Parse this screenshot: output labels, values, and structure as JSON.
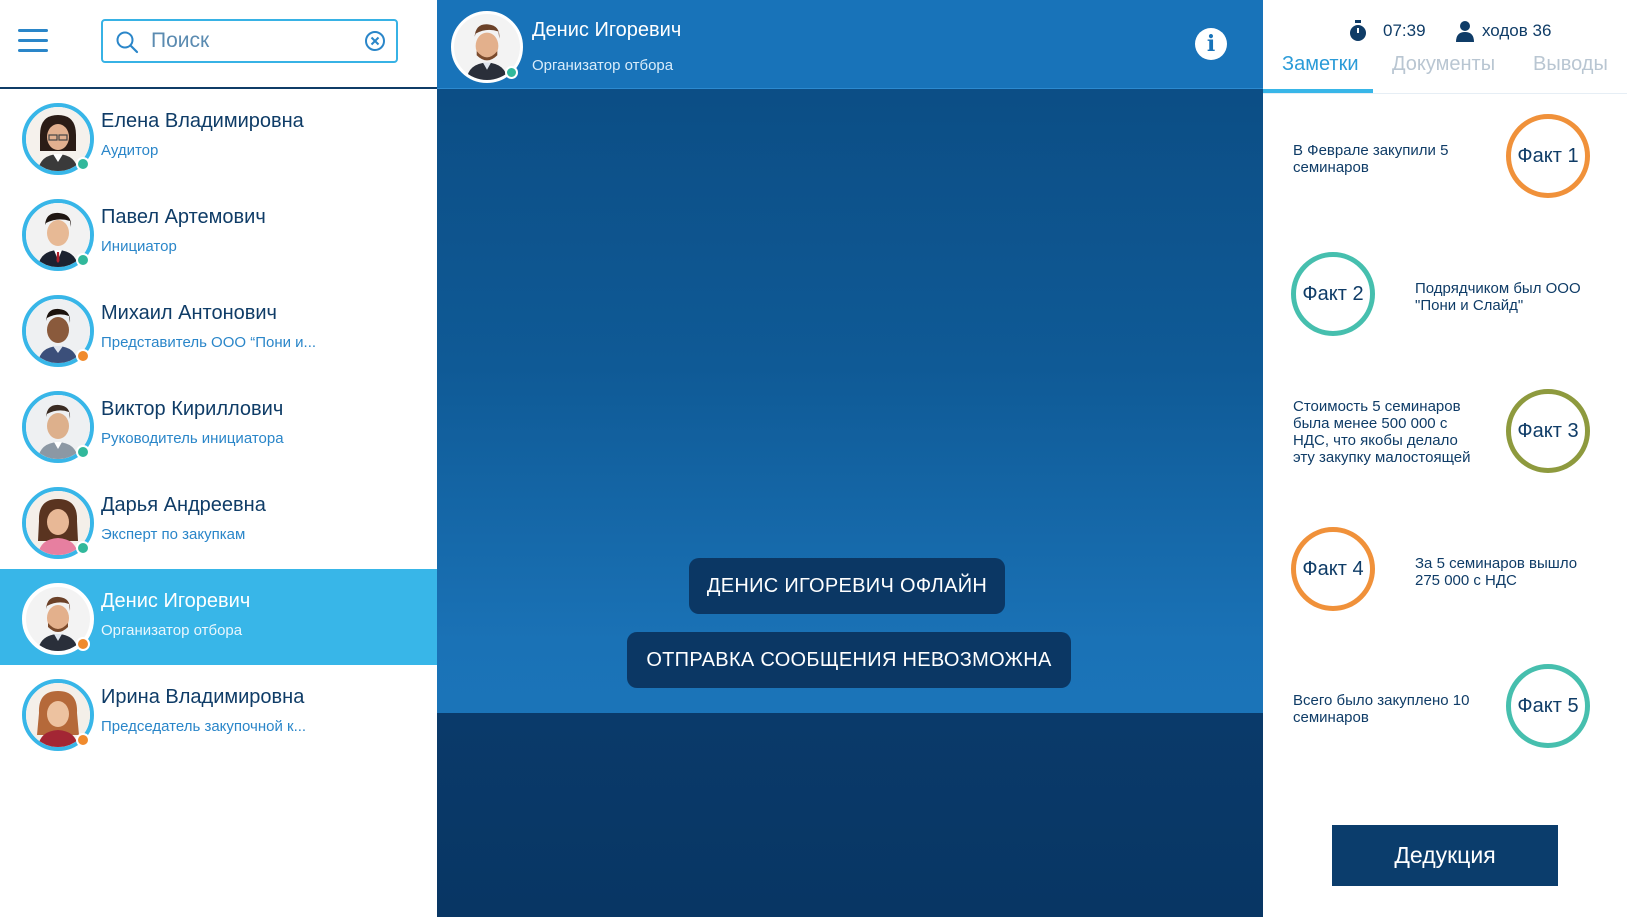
{
  "search": {
    "placeholder": "Поиск"
  },
  "contacts": [
    {
      "name": "Елена Владимировна",
      "role": "Аудитор",
      "status_color": "#31b89b",
      "active": false
    },
    {
      "name": "Павел Артемович",
      "role": "Инициатор",
      "status_color": "#31b89b",
      "active": false
    },
    {
      "name": "Михаил Антонович",
      "role": "Представитель ООО “Пони и...",
      "status_color": "#f08a2c",
      "active": false
    },
    {
      "name": "Виктор Кириллович",
      "role": "Руководитель инициатора",
      "status_color": "#31b89b",
      "active": false
    },
    {
      "name": "Дарья Андреевна",
      "role": "Эксперт по закупкам",
      "status_color": "#31b89b",
      "active": false
    },
    {
      "name": "Денис Игоревич",
      "role": "Организатор отбора",
      "status_color": "#f08a2c",
      "active": true
    },
    {
      "name": "Ирина Владимировна",
      "role": "Председатель закупочной к...",
      "status_color": "#f08a2c",
      "active": false
    }
  ],
  "chat": {
    "name": "Денис Игоревич",
    "role": "Организатор отбора",
    "status_color": "#31b89b",
    "messages": [
      "ДЕНИС ИГОРЕВИЧ ОФЛАЙН",
      "ОТПРАВКА СООБЩЕНИЯ НЕВОЗМОЖНА"
    ]
  },
  "stats": {
    "timer": "07:39",
    "moves": "ходов 36"
  },
  "tabs": [
    {
      "label": "Заметки",
      "active": true
    },
    {
      "label": "Документы",
      "active": false
    },
    {
      "label": "Выводы",
      "active": false
    }
  ],
  "facts": [
    {
      "label": "Факт 1",
      "text": "В Феврале закупили 5 семинаров",
      "color": "#f0913a"
    },
    {
      "label": "Факт 2",
      "text": "Подрядчиком был ООО \"Пони и Слайд\"",
      "color": "#46bfae"
    },
    {
      "label": "Факт 3",
      "text": "Стоимость 5 семинаров была менее 500 000 с НДС, что якобы делало эту закупку малостоящей",
      "color": "#8e9a3e"
    },
    {
      "label": "Факт 4",
      "text": "За 5 семинаров вышло 275 000 с НДС",
      "color": "#f0913a"
    },
    {
      "label": "Факт 5",
      "text": "Всего было закуплено 10 семинаров",
      "color": "#46bfae"
    }
  ],
  "deduce_label": "Дедукция",
  "colors": {
    "accent": "#38b6e8",
    "dark_blue": "#0b3d6c",
    "online": "#31b89b",
    "offline": "#f08a2c"
  }
}
